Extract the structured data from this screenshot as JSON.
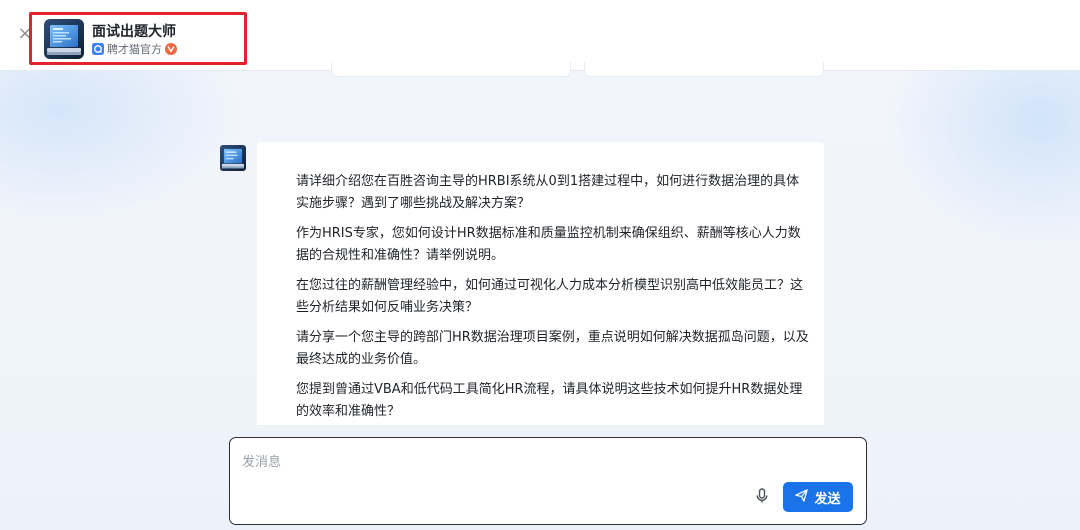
{
  "header": {
    "close_glyph": "×",
    "bot_name": "面试出题大师",
    "publisher": "聘才猫官方",
    "publisher_icon": "org-badge-icon",
    "verified_icon": "verified-badge-icon",
    "highlight_color": "#e5212b"
  },
  "chat": {
    "messages": [
      {
        "sender": "bot",
        "questions": [
          "请详细介绍您在百胜咨询主导的HRBI系统从0到1搭建过程中，如何进行数据治理的具体实施步骤？遇到了哪些挑战及解决方案？",
          "作为HRIS专家，您如何设计HR数据标准和质量监控机制来确保组织、薪酬等核心人力数据的合规性和准确性？请举例说明。",
          "在您过往的薪酬管理经验中，如何通过可视化人力成本分析模型识别高中低效能员工？这些分析结果如何反哺业务决策？",
          "请分享一个您主导的跨部门HR数据治理项目案例，重点说明如何解决数据孤岛问题，以及最终达成的业务价值。",
          "您提到曾通过VBA和低代码工具简化HR流程，请具体说明这些技术如何提升HR数据处理的效率和准确性？"
        ]
      }
    ]
  },
  "composer": {
    "placeholder": "发消息",
    "value": "",
    "mic_icon": "microphone-icon",
    "send_label": "发送",
    "send_icon": "paper-plane-icon",
    "send_color": "#1a73e8"
  }
}
